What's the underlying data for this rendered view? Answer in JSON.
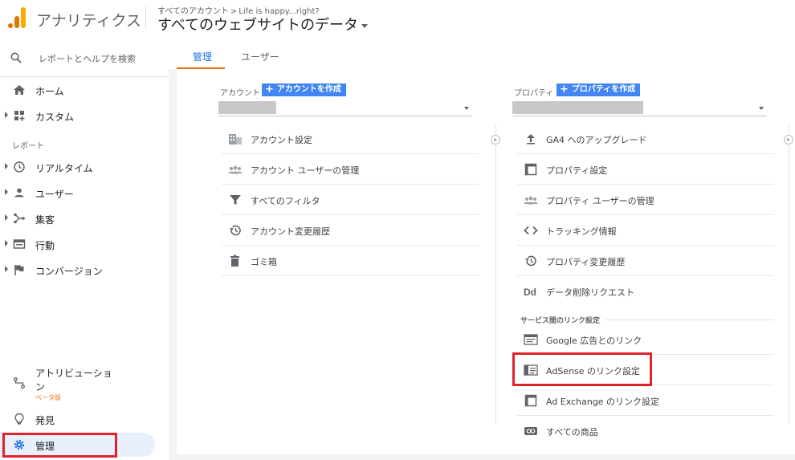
{
  "header": {
    "app_title": "アナリティクス",
    "breadcrumb": {
      "all_accounts": "すべてのアカウント",
      "separator": ">",
      "account": "Life is happy...right?"
    },
    "view_title": "すべてのウェブサイトのデータ"
  },
  "sidebar": {
    "search_placeholder": "レポートとヘルプを検索",
    "home": "ホーム",
    "custom": "カスタム",
    "reports_label": "レポート",
    "realtime": "リアルタイム",
    "user": "ユーザー",
    "acquisition": "集客",
    "behavior": "行動",
    "conversion": "コンバージョン",
    "attribution": "アトリビューション",
    "beta": "ベータ版",
    "discover": "発見",
    "admin": "管理"
  },
  "tabs": {
    "admin": "管理",
    "user": "ユーザー"
  },
  "account_column": {
    "header": "アカウント",
    "create_label": "アカウントを作成",
    "items": [
      "アカウント設定",
      "アカウント ユーザーの管理",
      "すべてのフィルタ",
      "アカウント変更履歴",
      "ゴミ箱"
    ]
  },
  "property_column": {
    "header": "プロパティ",
    "create_label": "プロパティを作成",
    "items": [
      "GA4 へのアップグレード",
      "プロパティ設定",
      "プロパティ ユーザーの管理",
      "トラッキング情報",
      "プロパティ変更履歴",
      "データ削除リクエスト"
    ],
    "linking_header": "サービス間のリンク設定",
    "linking_items": [
      "Google 広告とのリンク",
      "AdSense のリンク設定",
      "Ad Exchange のリンク設定",
      "すべての商品"
    ]
  },
  "colors": {
    "accent_blue": "#1a73e8",
    "button_blue": "#4285f4",
    "orange": "#e8710a",
    "highlight_red": "#e0232b",
    "active_bg": "#e8f0fe"
  }
}
